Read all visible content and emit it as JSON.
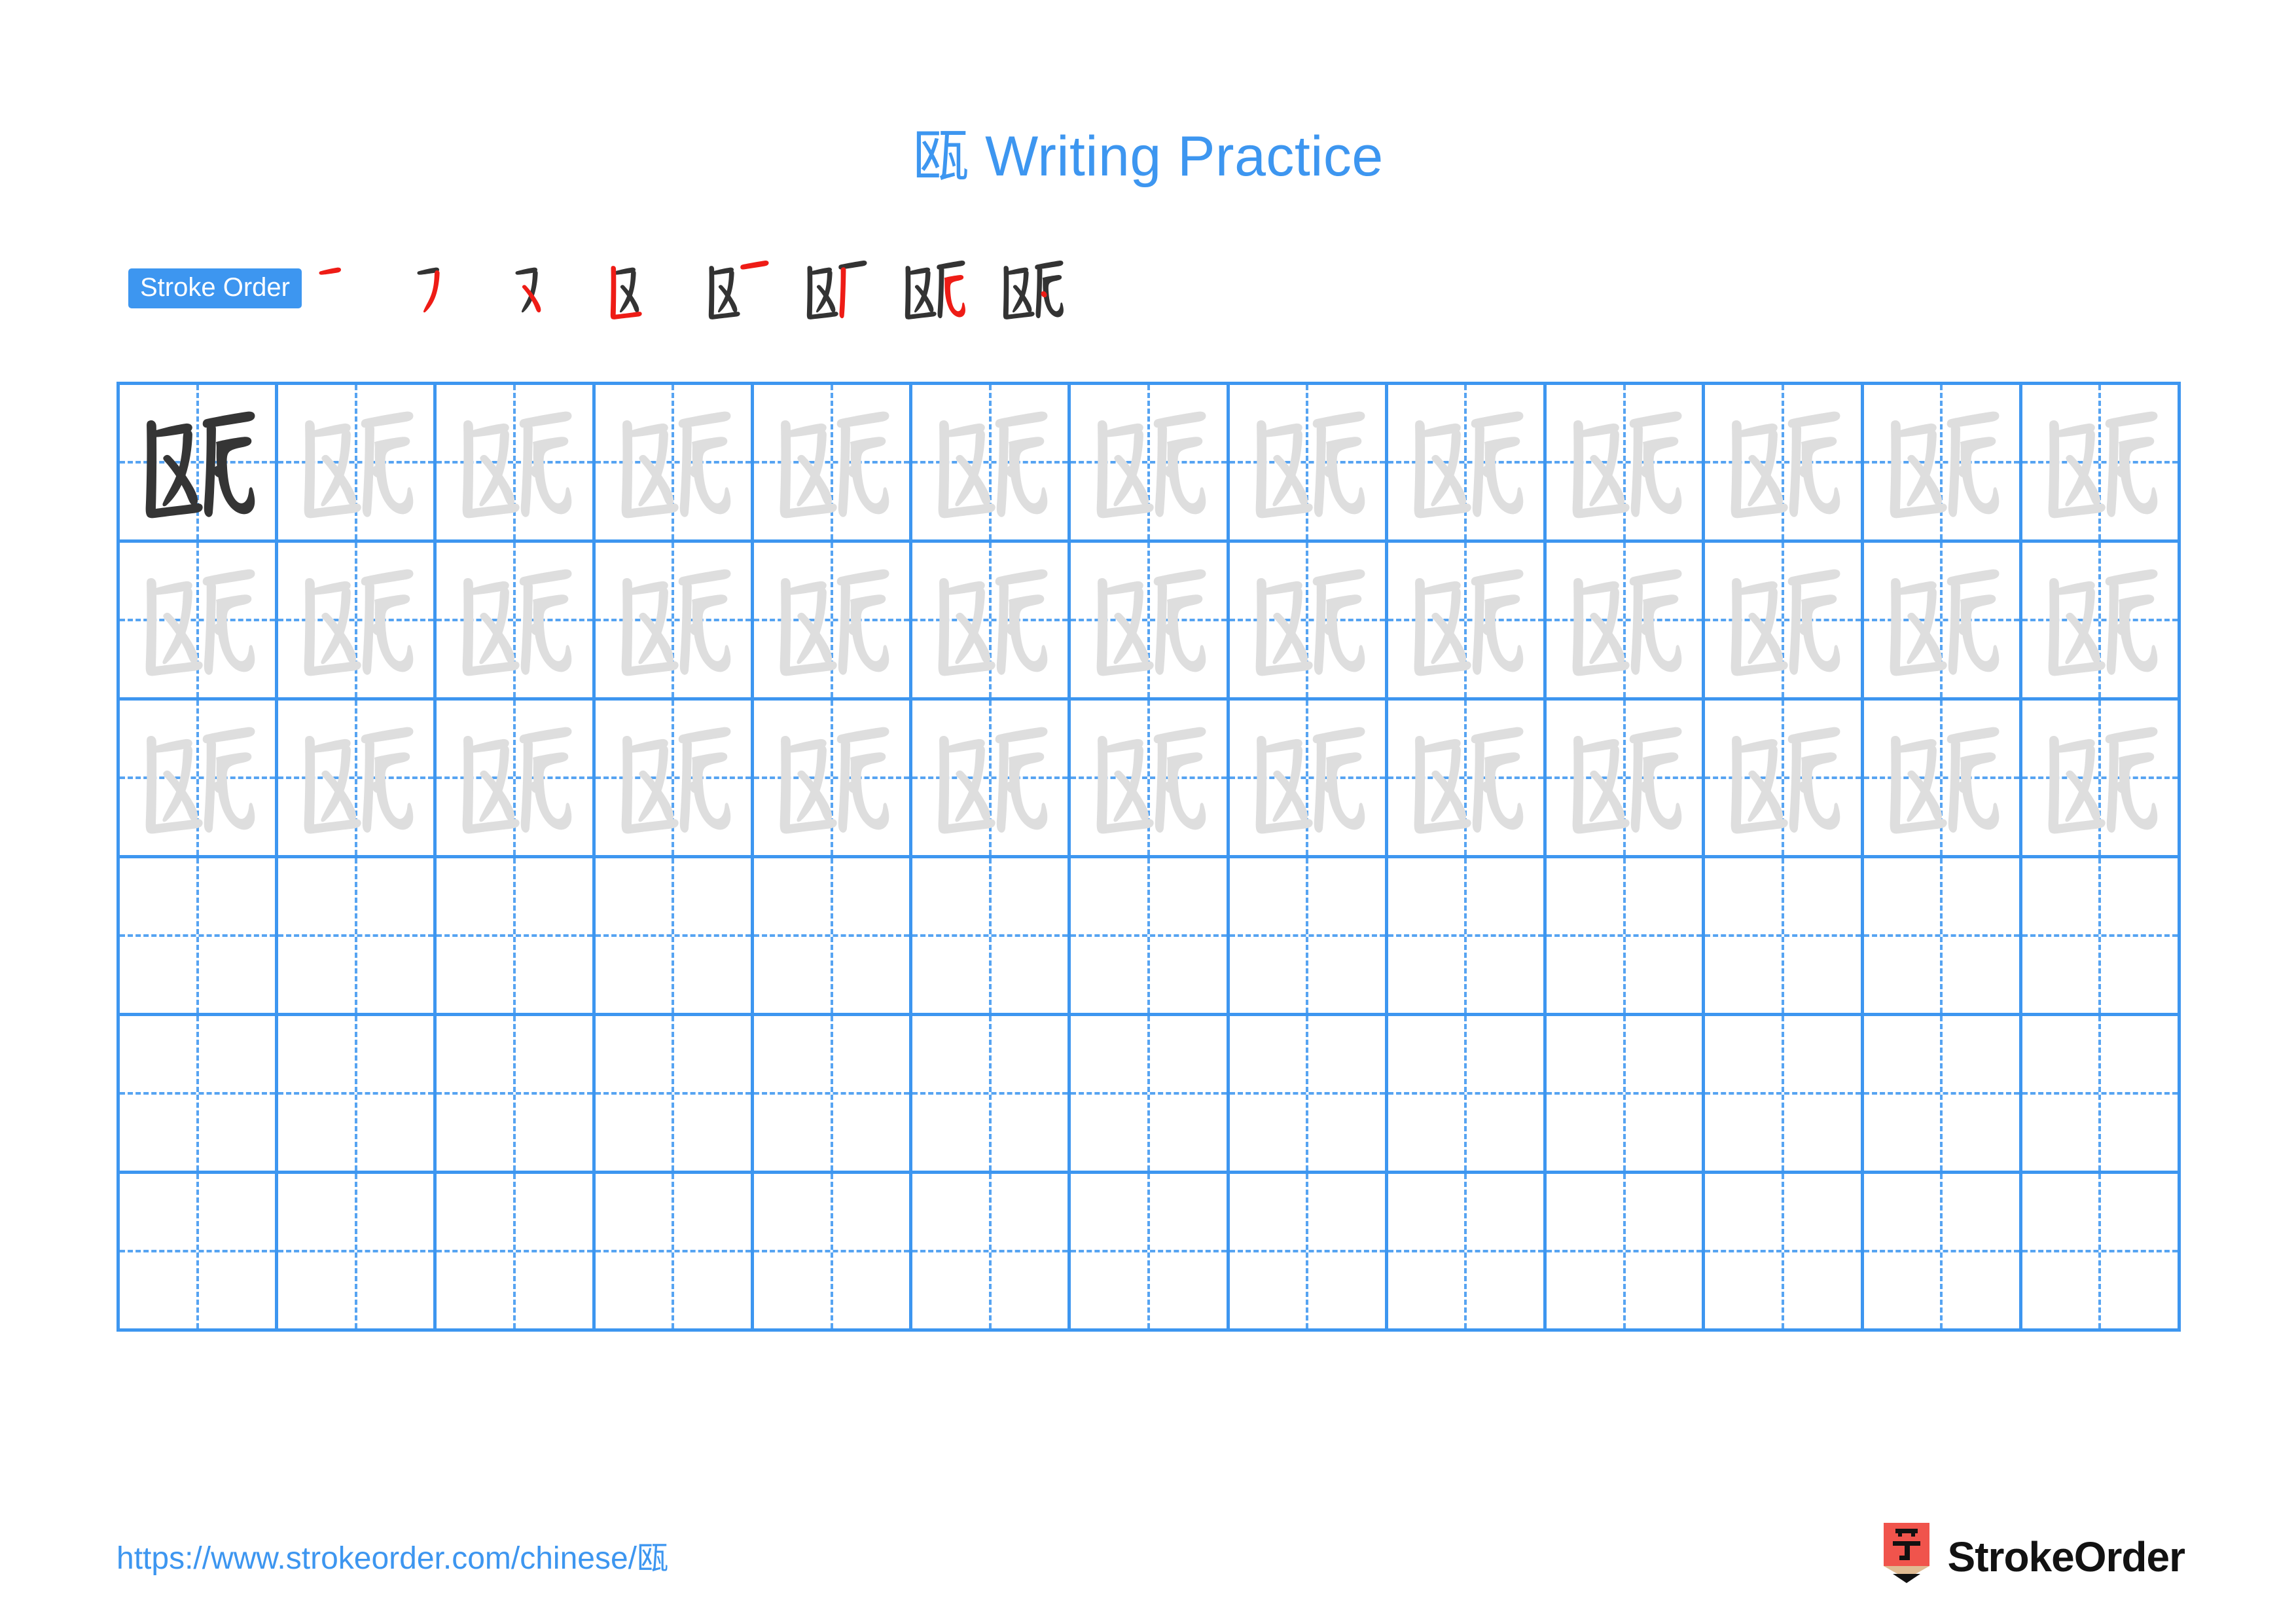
{
  "page": {
    "character": "瓯",
    "title": "瓯 Writing Practice",
    "background_color": "#ffffff",
    "accent_color": "#3d96f0",
    "new_stroke_color": "#ee1c16",
    "old_stroke_color": "#333333",
    "trace_ink_color": "#dedede",
    "model_ink_color": "#353535"
  },
  "stroke_order": {
    "badge_label": "Stroke Order",
    "total_strokes": 8,
    "steps": [
      {
        "index": 1,
        "stroke_name": "heng",
        "cumulative_strokes": 1
      },
      {
        "index": 2,
        "stroke_name": "pie",
        "cumulative_strokes": 2
      },
      {
        "index": 3,
        "stroke_name": "na",
        "cumulative_strokes": 3
      },
      {
        "index": 4,
        "stroke_name": "shu-zhe",
        "cumulative_strokes": 4
      },
      {
        "index": 5,
        "stroke_name": "heng",
        "cumulative_strokes": 5
      },
      {
        "index": 6,
        "stroke_name": "shu-wan",
        "cumulative_strokes": 6
      },
      {
        "index": 7,
        "stroke_name": "heng-zhe-wan-gou",
        "cumulative_strokes": 7
      },
      {
        "index": 8,
        "stroke_name": "dian",
        "cumulative_strokes": 8
      }
    ]
  },
  "practice_grid": {
    "columns": 13,
    "rows": 6,
    "model_cell": {
      "row": 1,
      "column": 1
    },
    "traced_rows": [
      1,
      2,
      3
    ],
    "blank_rows": [
      4,
      5,
      6
    ],
    "cell_character": "瓯"
  },
  "footer": {
    "url": "https://www.strokeorder.com/chinese/瓯",
    "brand_name": "StrokeOrder",
    "logo_glyph": "字",
    "logo_body_color": "#f0544c",
    "logo_wood_color": "#e0bb92",
    "logo_tip_color": "#111111"
  }
}
